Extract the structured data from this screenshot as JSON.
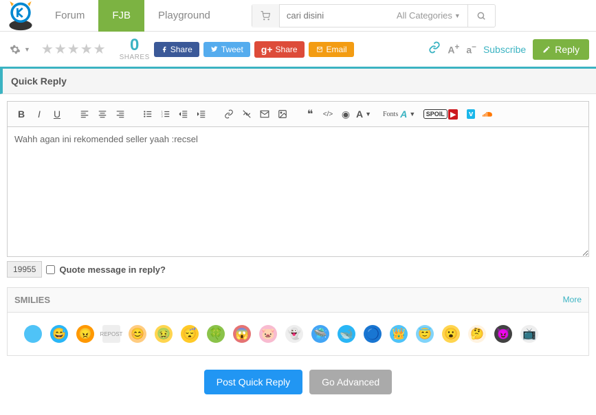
{
  "nav": {
    "items": [
      "Forum",
      "FJB",
      "Playground"
    ],
    "active_index": 1
  },
  "search": {
    "placeholder": "cari disini",
    "category": "All Categories"
  },
  "toolbar": {
    "shares_count": "0",
    "shares_label": "SHARES",
    "fb": "Share",
    "tw": "Tweet",
    "gp": "Share",
    "em": "Email",
    "subscribe": "Subscribe",
    "reply": "Reply"
  },
  "quick_reply": {
    "title": "Quick Reply",
    "textarea_value": "Wahh agan ini rekomended seller yaah :recsel",
    "post_id": "19955",
    "quote_label": "Quote message in reply?"
  },
  "editor": {
    "fonts_label": "Fonts"
  },
  "smilies": {
    "header": "SMILIES",
    "more": "More",
    "items": [
      "s1",
      "s2",
      "s3",
      "s4",
      "s5",
      "s6",
      "s7",
      "s8",
      "s9",
      "s10",
      "s11",
      "s12",
      "s13",
      "s14",
      "s15",
      "s16",
      "s17",
      "s18",
      "s19",
      "s20"
    ]
  },
  "buttons": {
    "post": "Post Quick Reply",
    "advanced": "Go Advanced"
  }
}
